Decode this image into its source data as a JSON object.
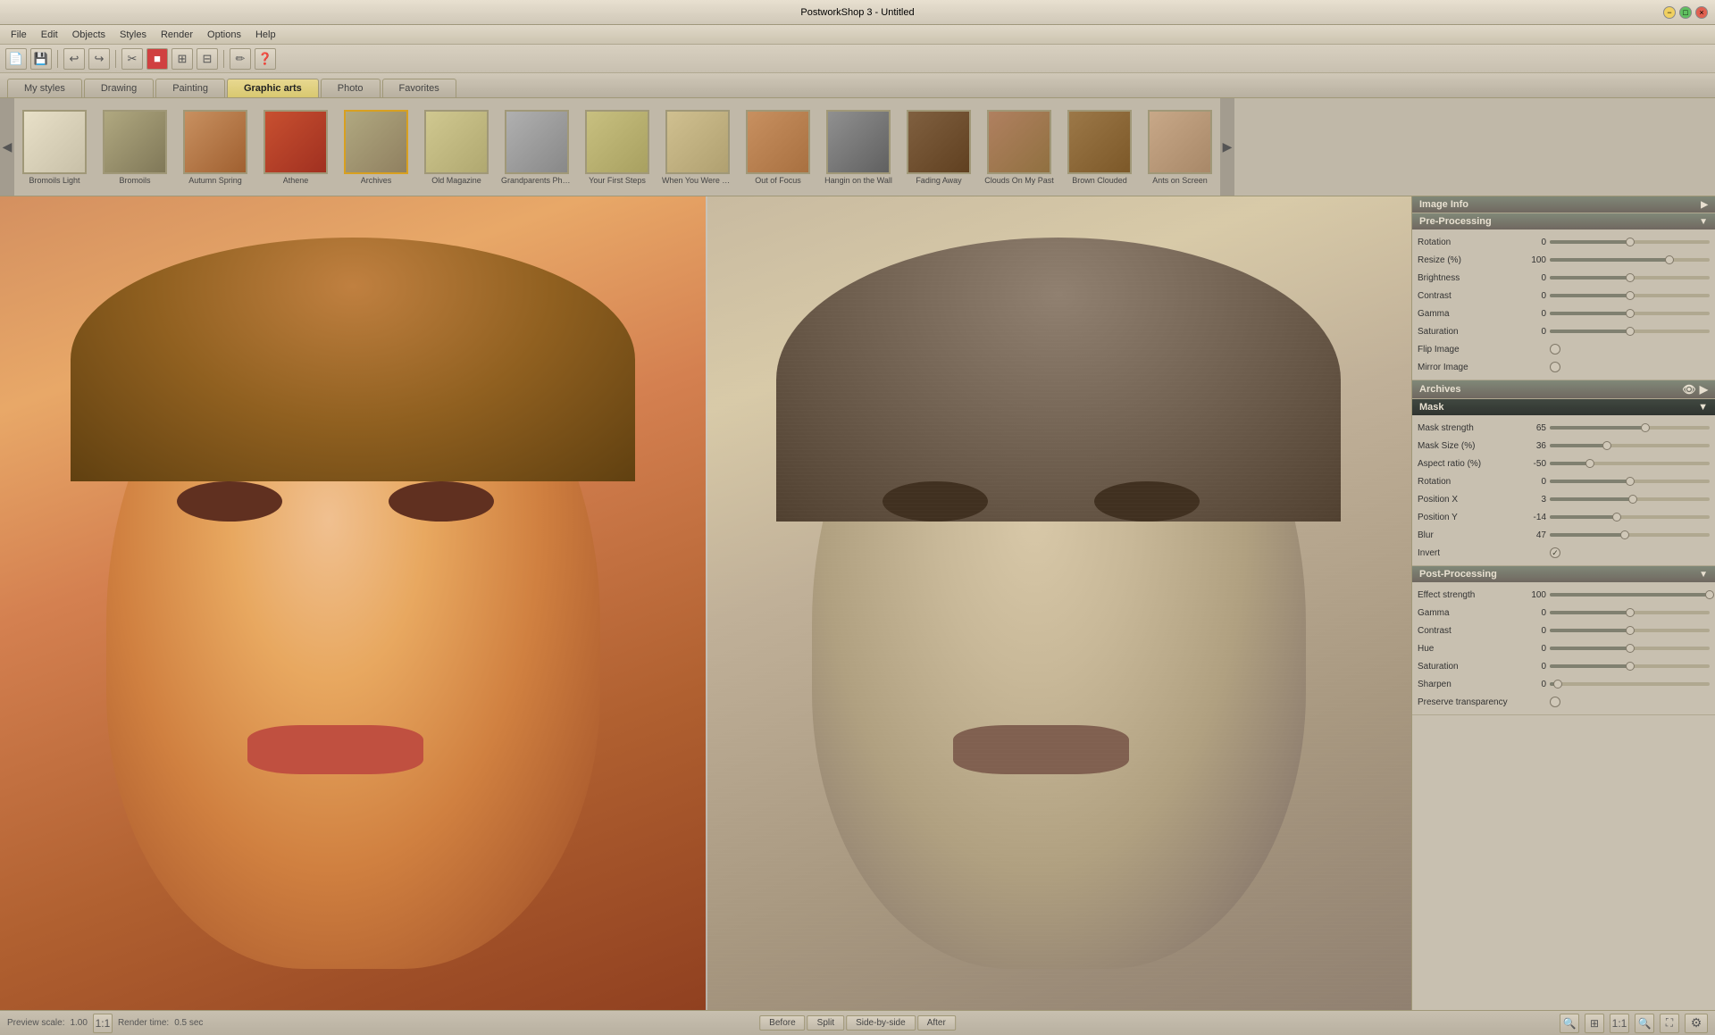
{
  "titlebar": {
    "title": "PostworkShop 3 - Untitled",
    "btn_min": "−",
    "btn_max": "□",
    "btn_close": "×"
  },
  "menubar": {
    "items": [
      "File",
      "Edit",
      "Objects",
      "Styles",
      "Render",
      "Options",
      "Help"
    ]
  },
  "toolbar": {
    "buttons": [
      "📄",
      "💾",
      "↩",
      "↪",
      "✂",
      "⬜",
      "🖼",
      "⬛",
      "◼",
      "◻",
      "📏",
      "❓"
    ]
  },
  "tabs": {
    "items": [
      "My styles",
      "Drawing",
      "Painting",
      "Graphic arts",
      "Photo",
      "Favorites"
    ],
    "active": "Graphic arts"
  },
  "style_strip": {
    "styles": [
      {
        "label": "Bromoils Light",
        "thumb_class": "thumb-bromolls-light"
      },
      {
        "label": "Bromoils",
        "thumb_class": "thumb-bromolls"
      },
      {
        "label": "Autumn Spring",
        "thumb_class": "thumb-autumn"
      },
      {
        "label": "Athene",
        "thumb_class": "thumb-athene"
      },
      {
        "label": "Archives",
        "thumb_class": "thumb-archives",
        "active": true
      },
      {
        "label": "Old Magazine",
        "thumb_class": "thumb-old-mag"
      },
      {
        "label": "Grandparents Photo",
        "thumb_class": "thumb-grandparents"
      },
      {
        "label": "Your First Steps",
        "thumb_class": "thumb-first-steps"
      },
      {
        "label": "When You Were Young",
        "thumb_class": "thumb-young"
      },
      {
        "label": "Out of Focus",
        "thumb_class": "thumb-out-focus"
      },
      {
        "label": "Hangin on the Wall",
        "thumb_class": "thumb-hangin"
      },
      {
        "label": "Fading Away",
        "thumb_class": "thumb-fading"
      },
      {
        "label": "Clouds On My Past",
        "thumb_class": "thumb-clouds"
      },
      {
        "label": "Brown Clouded",
        "thumb_class": "thumb-brown"
      },
      {
        "label": "Ants on Screen",
        "thumb_class": "thumb-ants"
      }
    ]
  },
  "view_buttons": [
    "Before",
    "Split",
    "Side-by-side",
    "After"
  ],
  "bottom_bar": {
    "preview_scale_label": "Preview scale:",
    "preview_scale_value": "1.00",
    "ratio_btn": "1:1",
    "render_time_label": "Render time:",
    "render_time_value": "0.5 sec"
  },
  "right_panel": {
    "image_info": {
      "header": "Image Info",
      "collapsed": true
    },
    "pre_processing": {
      "header": "Pre-Processing",
      "params": [
        {
          "label": "Rotation",
          "value": "0",
          "percent": 50
        },
        {
          "label": "Resize (%)",
          "value": "100",
          "percent": 75
        },
        {
          "label": "Brightness",
          "value": "0",
          "percent": 50
        },
        {
          "label": "Contrast",
          "value": "0",
          "percent": 50
        },
        {
          "label": "Gamma",
          "value": "0",
          "percent": 50
        },
        {
          "label": "Saturation",
          "value": "0",
          "percent": 50
        },
        {
          "label": "Flip Image",
          "value": "",
          "type": "checkbox",
          "checked": false
        },
        {
          "label": "Mirror Image",
          "value": "",
          "type": "checkbox",
          "checked": false
        }
      ]
    },
    "archives": {
      "header": "Archives"
    },
    "mask": {
      "header": "Mask",
      "params": [
        {
          "label": "Mask strength",
          "value": "65",
          "percent": 60
        },
        {
          "label": "Mask Size (%)",
          "value": "36",
          "percent": 36
        },
        {
          "label": "Aspect ratio (%)",
          "value": "-50",
          "percent": 25
        },
        {
          "label": "Rotation",
          "value": "0",
          "percent": 50
        },
        {
          "label": "Position X",
          "value": "3",
          "percent": 52
        },
        {
          "label": "Position Y",
          "value": "-14",
          "percent": 42
        },
        {
          "label": "Blur",
          "value": "47",
          "percent": 47
        },
        {
          "label": "Invert",
          "value": "",
          "type": "checkbox",
          "checked": true
        }
      ]
    },
    "post_processing": {
      "header": "Post-Processing",
      "params": [
        {
          "label": "Effect strength",
          "value": "100",
          "percent": 100
        },
        {
          "label": "Gamma",
          "value": "0",
          "percent": 50
        },
        {
          "label": "Contrast",
          "value": "0",
          "percent": 50
        },
        {
          "label": "Hue",
          "value": "0",
          "percent": 50
        },
        {
          "label": "Saturation",
          "value": "0",
          "percent": 50
        },
        {
          "label": "Sharpen",
          "value": "0",
          "percent": 0
        },
        {
          "label": "Preserve transparency",
          "value": "",
          "type": "checkbox",
          "checked": false
        }
      ]
    }
  }
}
